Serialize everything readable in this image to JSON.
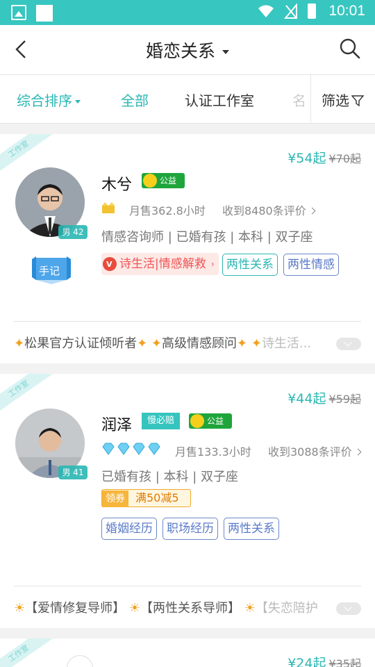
{
  "status_bar": {
    "time": "10:01"
  },
  "nav": {
    "title": "婚恋关系"
  },
  "filters": {
    "sort_label": "综合排序",
    "all_label": "全部",
    "studio_label": "认证工作室",
    "more_label": "名",
    "filter_label": "筛选"
  },
  "accent_color": "#2ab7b4",
  "listings": [
    {
      "corner": "工作室",
      "price": "¥54起",
      "orig_price": "¥70起",
      "name": "木兮",
      "welfare": "公益",
      "gender": "男 42",
      "sales": "月售362.8小时",
      "reviews": "收到8480条评价",
      "profile": "情感咨询师 | 已婚有孩 | 本科 | 双子座",
      "notes_badge": "手记",
      "featured_tag": "诗生活|情感解救",
      "tags": [
        "两性关系",
        "两性情感"
      ],
      "honors": "松果官方认证倾听者",
      "honors2": "高级情感顾问",
      "honors3": "诗生活..."
    },
    {
      "corner": "工作室",
      "price": "¥44起",
      "orig_price": "¥59起",
      "name": "润泽",
      "slow_pay": "慢必赔",
      "welfare": "公益",
      "gender": "男 41",
      "sales": "月售133.3小时",
      "reviews": "收到3088条评价",
      "profile": "已婚有孩 | 本科 | 双子座",
      "coupon_label": "领券",
      "coupon_text": "满50减5",
      "tags": [
        "婚姻经历",
        "职场经历",
        "两性关系"
      ],
      "roles": [
        "【爱情修复导师】",
        "【两性关系导师】",
        "【失恋陪护"
      ]
    },
    {
      "corner": "工作室",
      "price": "¥24起",
      "orig_price": "¥35起"
    }
  ]
}
